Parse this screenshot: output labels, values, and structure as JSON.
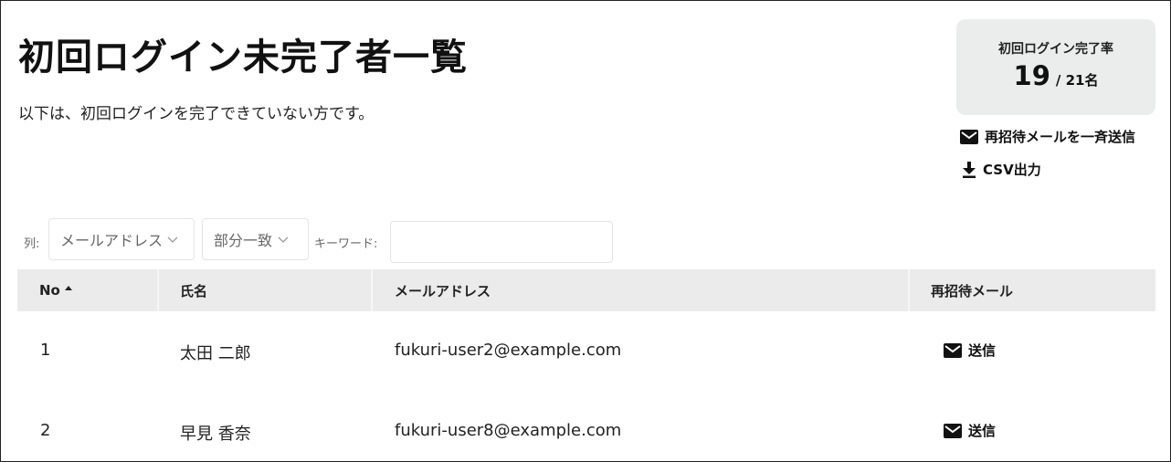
{
  "page": {
    "title": "初回ログイン未完了者一覧",
    "subtitle": "以下は、初回ログインを完了できていない方です。"
  },
  "stat": {
    "label": "初回ログイン完了率",
    "completed": "19",
    "total": "/ 21名"
  },
  "actions": {
    "reinvite_all": "再招待メールを一斉送信",
    "csv_export": "CSV出力"
  },
  "filter": {
    "column_label": "列:",
    "column_value": "メールアドレス",
    "match_value": "部分一致",
    "keyword_label": "キーワード:",
    "keyword_value": "",
    "keyword_placeholder": ""
  },
  "table": {
    "headers": {
      "no": "No",
      "name": "氏名",
      "email": "メールアドレス",
      "reinvite": "再招待メール"
    },
    "sort": {
      "column": "no",
      "direction": "asc"
    },
    "rows": [
      {
        "no": "1",
        "name": "太田 二郎",
        "email": "fukuri-user2@example.com",
        "action": "送信"
      },
      {
        "no": "2",
        "name": "早見 香奈",
        "email": "fukuri-user8@example.com",
        "action": "送信"
      }
    ]
  },
  "icons": {
    "reinvite_all": "mail-icon",
    "csv_export": "download-icon",
    "send": "mail-icon",
    "sort": "sort-up-icon",
    "dropdown": "chevron-down-icon"
  }
}
